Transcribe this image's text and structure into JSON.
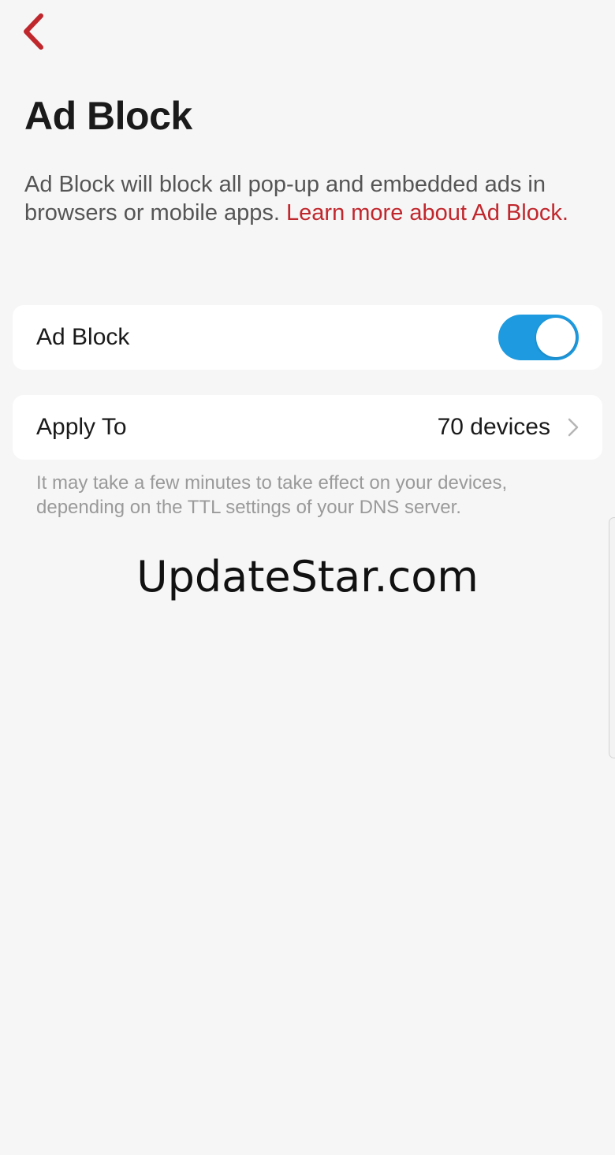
{
  "header": {
    "back_icon": "chevron-left-icon",
    "title": "Ad Block"
  },
  "description": {
    "text": "Ad Block will block all pop-up and embedded ads in browsers or mobile apps. ",
    "link_text": "Learn more about Ad Block."
  },
  "adblock_setting": {
    "label": "Ad Block",
    "enabled": true
  },
  "apply_to": {
    "label": "Apply To",
    "value": "70 devices",
    "chevron_icon": "chevron-right-icon"
  },
  "note": "It may take a few minutes to take effect on your devices, depending on the TTL settings of your DNS server.",
  "watermark": "UpdateStar.com",
  "colors": {
    "accent_red": "#c0272d",
    "toggle_blue": "#1e9be0",
    "background": "#f6f6f6"
  }
}
